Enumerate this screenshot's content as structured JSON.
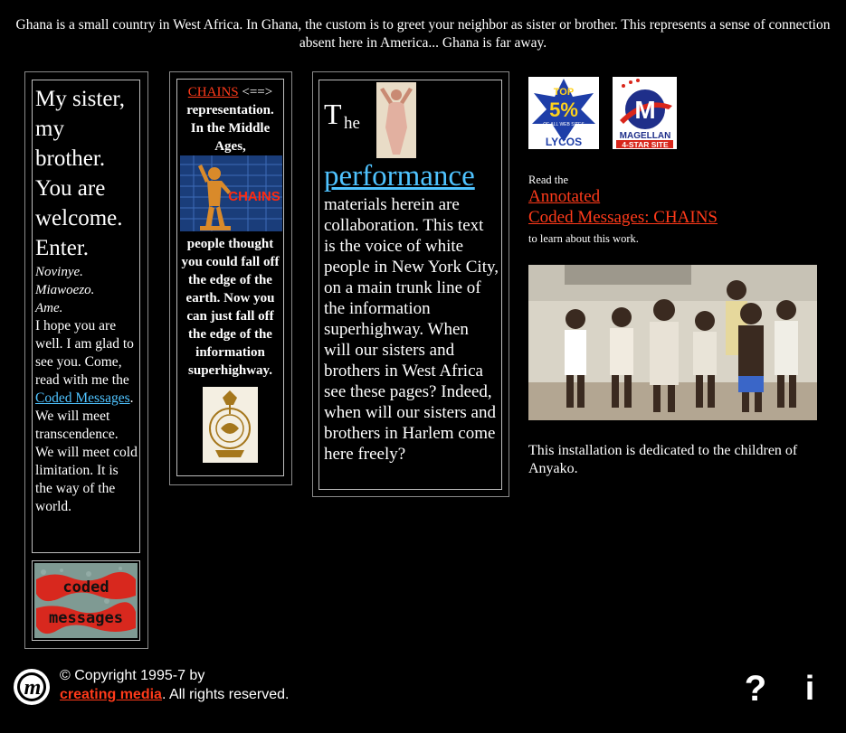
{
  "intro": "Ghana is a small country in West Africa. In Ghana, the custom is to greet your neighbor as sister or brother. This represents a sense of connection absent here in America... Ghana is far away.",
  "col1": {
    "welcome": [
      "My sister,",
      "my",
      "brother.",
      "You are",
      "welcome.",
      "Enter."
    ],
    "natives": [
      "Novinye.",
      "Miawoezo.",
      "Ame."
    ],
    "text_before": "I hope you are well. I am glad to see you. Come, read with me the",
    "link": "Coded Messages",
    "text_after": ". We will meet transcendence. We will meet cold limitation. It is the way of the world.",
    "button_line1": "coded",
    "button_line2": "messages"
  },
  "col2": {
    "chains_link": "CHAINS",
    "arrow": "<==>",
    "text1": "representation. In the Middle Ages,",
    "image_label": "CHAINS",
    "text2": "people thought you could fall off the edge of the earth. Now you can just fall off the edge of the information superhighway."
  },
  "col3": {
    "the_big": "T",
    "the_small": "he",
    "performance": "performance",
    "text": "materials herein are collaboration. This text is the voice of white people in New York City, on a main trunk line of the information superhighway. When will our sisters and brothers in West Africa see these pages? Indeed, when will our sisters and brothers in Harlem come here freely?"
  },
  "badges": {
    "lycos_top": "TOP",
    "lycos_pct": "5%",
    "lycos_of": "OF ALL WEB SITES",
    "lycos_name": "LYCOS",
    "magellan_name": "MAGELLAN",
    "magellan_rating": "4-STAR SITE"
  },
  "right": {
    "read_label": "Read the",
    "annotated": "Annotated",
    "coded_chains": "Coded Messages: CHAINS",
    "learn": "to learn about this work.",
    "dedication": "This installation is dedicated to the children of Anyako."
  },
  "footer": {
    "copyright": "© Copyright 1995-7 by ",
    "company": "creating media",
    "rights": ". All rights reserved.",
    "logo_letter": "m",
    "help_glyph": "?",
    "info_glyph": "i"
  }
}
